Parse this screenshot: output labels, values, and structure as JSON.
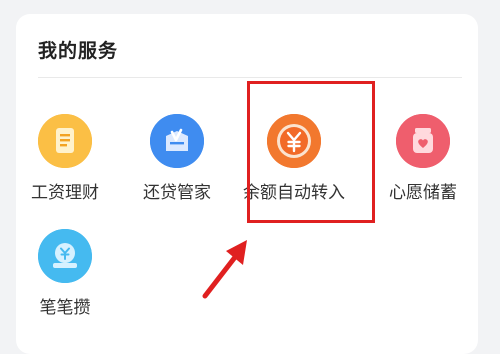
{
  "services": {
    "title": "我的服务",
    "items": [
      {
        "label": "工资理财",
        "icon": "wage-finance-icon",
        "color": "#f9b43a"
      },
      {
        "label": "还贷管家",
        "icon": "loan-repayment-icon",
        "color": "#3d8ef0"
      },
      {
        "label": "余额自动转入",
        "icon": "yuan-icon",
        "color": "#f26a28"
      },
      {
        "label": "心愿储蓄",
        "icon": "wish-jar-icon",
        "color": "#ef5a6a"
      },
      {
        "label": "笔笔攒",
        "icon": "piggy-bank-icon",
        "color": "#40b8ec"
      }
    ]
  },
  "annotation": {
    "highlight_color": "#e02020",
    "highlighted_item": "余额自动转入"
  }
}
